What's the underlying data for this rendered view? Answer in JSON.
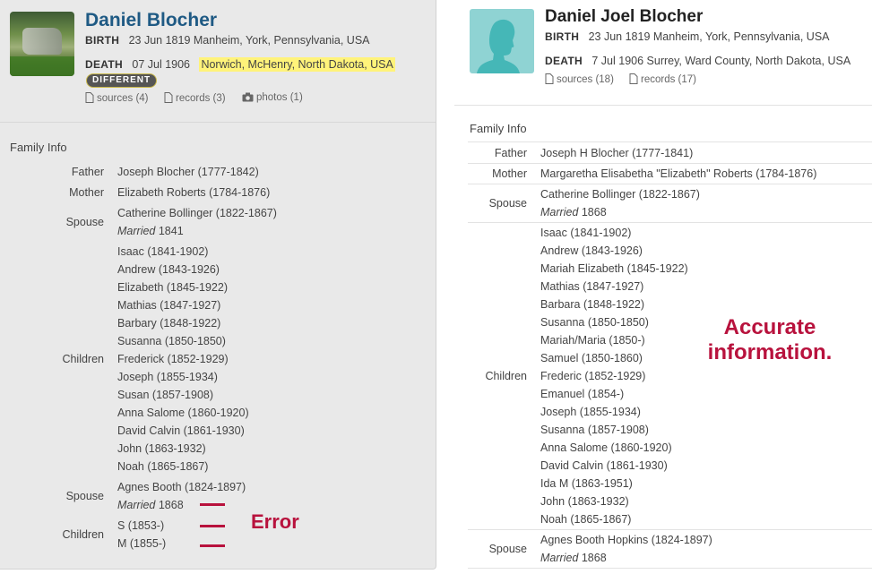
{
  "left": {
    "name": "Daniel Blocher",
    "birth_label": "BIRTH",
    "birth_value": "23 Jun 1819 Manheim, York, Pennsylvania, USA",
    "death_label": "DEATH",
    "death_date": "07 Jul 1906",
    "death_place": "Norwich, McHenry, North Dakota, USA",
    "badge": "DIFFERENT",
    "sources": "sources (4)",
    "records": "records (3)",
    "photos": "photos (1)",
    "family_title": "Family Info",
    "father_label": "Father",
    "father": "Joseph Blocher (1777-1842)",
    "mother_label": "Mother",
    "mother": "Elizabeth Roberts (1784-1876)",
    "spouse1_label": "Spouse",
    "spouse1": "Catherine Bollinger (1822-1867)",
    "spouse1_married_word": "Married",
    "spouse1_married_year": "1841",
    "children1_label": "Children",
    "children1": [
      "Isaac (1841-1902)",
      "Andrew (1843-1926)",
      "Elizabeth (1845-1922)",
      "Mathias (1847-1927)",
      "Barbary (1848-1922)",
      "Susanna (1850-1850)",
      "Frederick (1852-1929)",
      "Joseph (1855-1934)",
      "Susan (1857-1908)",
      "Anna Salome (1860-1920)",
      "David Calvin (1861-1930)",
      "John (1863-1932)",
      "Noah (1865-1867)"
    ],
    "spouse2_label": "Spouse",
    "spouse2": "Agnes Booth (1824-1897)",
    "spouse2_married_word": "Married",
    "spouse2_married_year": "1868",
    "children2_label": "Children",
    "children2": [
      "S (1853-)",
      "M (1855-)"
    ],
    "annotation": "Error"
  },
  "right": {
    "name": "Daniel Joel Blocher",
    "birth_label": "BIRTH",
    "birth_value": "23 Jun 1819 Manheim, York, Pennsylvania, USA",
    "death_label": "DEATH",
    "death_value": "7 Jul 1906 Surrey, Ward County, North Dakota, USA",
    "sources": "sources (18)",
    "records": "records (17)",
    "family_title": "Family Info",
    "father_label": "Father",
    "father": "Joseph H Blocher (1777-1841)",
    "mother_label": "Mother",
    "mother": "Margaretha Elisabetha \"Elizabeth\" Roberts (1784-1876)",
    "spouse1_label": "Spouse",
    "spouse1": "Catherine Bollinger (1822-1867)",
    "spouse1_married_word": "Married",
    "spouse1_married_year": "1868",
    "children_label": "Children",
    "children": [
      "Isaac (1841-1902)",
      "Andrew (1843-1926)",
      "Mariah Elizabeth (1845-1922)",
      "Mathias (1847-1927)",
      "Barbara (1848-1922)",
      "Susanna (1850-1850)",
      "Mariah/Maria (1850-)",
      "Samuel (1850-1860)",
      "Frederic (1852-1929)",
      "Emanuel (1854-)",
      "Joseph (1855-1934)",
      "Susanna (1857-1908)",
      "Anna Salome (1860-1920)",
      "David Calvin (1861-1930)",
      "Ida M (1863-1951)",
      "John (1863-1932)",
      "Noah (1865-1867)"
    ],
    "spouse2_label": "Spouse",
    "spouse2": "Agnes Booth Hopkins (1824-1897)",
    "spouse2_married_word": "Married",
    "spouse2_married_year": "1868",
    "annotation": "Accurate information."
  },
  "colors": {
    "annotation": "#b8123d",
    "highlight": "#fff37a",
    "name_link": "#1f5a84"
  }
}
